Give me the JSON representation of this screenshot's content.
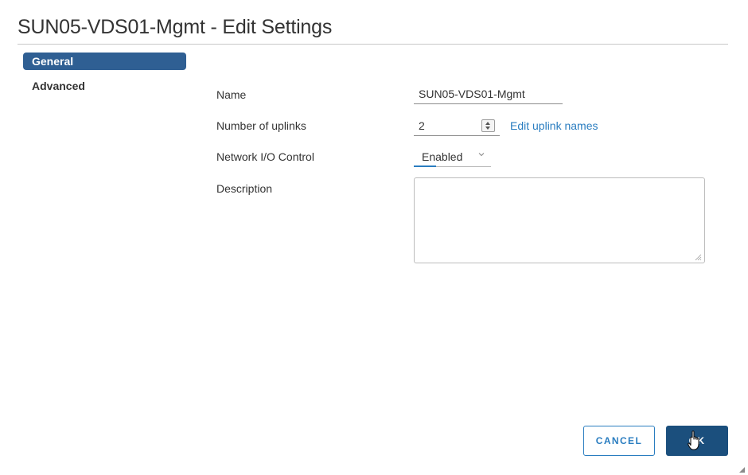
{
  "dialog": {
    "title": "SUN05-VDS01-Mgmt - Edit Settings"
  },
  "nav": {
    "items": [
      {
        "label": "General",
        "active": true
      },
      {
        "label": "Advanced",
        "active": false
      }
    ]
  },
  "form": {
    "name_label": "Name",
    "name_value": "SUN05-VDS01-Mgmt",
    "uplinks_label": "Number of uplinks",
    "uplinks_value": "2",
    "edit_uplinks_link": "Edit uplink names",
    "nioc_label": "Network I/O Control",
    "nioc_value": "Enabled",
    "description_label": "Description",
    "description_value": ""
  },
  "footer": {
    "cancel_label": "CANCEL",
    "ok_label": "OK"
  },
  "icons": {
    "stepper": "stepper-icon",
    "dropdown": "chevron-down-icon",
    "resize": "resize-handle-icon",
    "cursor": "hand-pointer-icon"
  },
  "colors": {
    "nav_active_bg": "#2f5f93",
    "link": "#2a7dc0",
    "primary_button": "#1b4f7d"
  }
}
